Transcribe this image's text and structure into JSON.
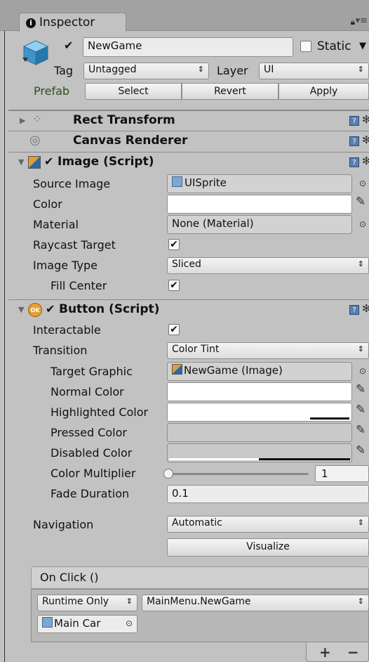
{
  "window": {
    "tab_label": "Inspector",
    "tab_icon": "info-icon"
  },
  "gameobject": {
    "active": true,
    "name": "NewGame",
    "static_label": "Static",
    "static_checked": false,
    "tag_label": "Tag",
    "tag_value": "Untagged",
    "layer_label": "Layer",
    "layer_value": "UI",
    "prefab_label": "Prefab",
    "prefab_buttons": [
      "Select",
      "Revert",
      "Apply"
    ]
  },
  "components": {
    "rect_transform": {
      "title": "Rect Transform"
    },
    "canvas_renderer": {
      "title": "Canvas Renderer"
    },
    "image": {
      "title": "Image (Script)",
      "enabled": true,
      "source_image_label": "Source Image",
      "source_image_value": "UISprite",
      "color_label": "Color",
      "color_value": "#ffffff",
      "material_label": "Material",
      "material_value": "None (Material)",
      "raycast_label": "Raycast Target",
      "raycast_checked": true,
      "image_type_label": "Image Type",
      "image_type_value": "Sliced",
      "fill_center_label": "Fill Center",
      "fill_center_checked": true
    },
    "button": {
      "title": "Button (Script)",
      "enabled": true,
      "interactable_label": "Interactable",
      "interactable_checked": true,
      "transition_label": "Transition",
      "transition_value": "Color Tint",
      "target_graphic_label": "Target Graphic",
      "target_graphic_value": "NewGame (Image)",
      "normal_color_label": "Normal Color",
      "highlighted_color_label": "Highlighted Color",
      "pressed_color_label": "Pressed Color",
      "disabled_color_label": "Disabled Color",
      "color_multiplier_label": "Color Multiplier",
      "color_multiplier_value": "1",
      "color_multiplier_slider": 0.0,
      "fade_duration_label": "Fade Duration",
      "fade_duration_value": "0.1",
      "navigation_label": "Navigation",
      "navigation_value": "Automatic",
      "visualize_label": "Visualize",
      "onclick": {
        "header": "On Click ()",
        "runtime_value": "Runtime Only",
        "function_value": "MainMenu.NewGame",
        "object_value": "Main Car",
        "add_label": "+",
        "remove_label": "−"
      }
    }
  },
  "colors": {
    "panel_bg": "#c2c2c2",
    "accent_blue": "#5a7fb0"
  }
}
